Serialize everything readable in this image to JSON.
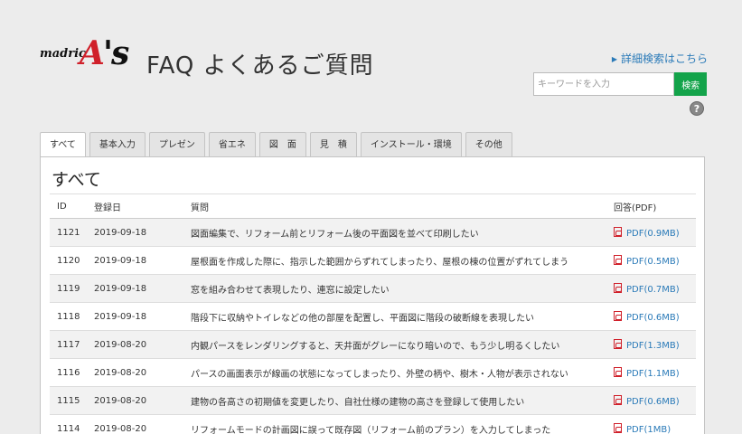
{
  "logo": {
    "small": "madric",
    "big_a": "A",
    "big_rest": "'s"
  },
  "page_title": "FAQ よくあるご質問",
  "advanced_search_link": "詳細検索はこちら",
  "search": {
    "placeholder": "キーワードを入力",
    "button": "検索"
  },
  "help_icon_label": "?",
  "tabs": [
    "すべて",
    "基本入力",
    "プレゼン",
    "省エネ",
    "図　面",
    "見　積",
    "インストール・環境",
    "その他"
  ],
  "active_tab": 0,
  "panel_title": "すべて",
  "table": {
    "headers": {
      "id": "ID",
      "date": "登録日",
      "question": "質問",
      "pdf": "回答(PDF)"
    },
    "rows": [
      {
        "id": "1121",
        "date": "2019-09-18",
        "question": "図面編集で、リフォーム前とリフォーム後の平面図を並べて印刷したい",
        "pdf": "PDF(0.9MB)"
      },
      {
        "id": "1120",
        "date": "2019-09-18",
        "question": "屋根面を作成した際に、指示した範囲からずれてしまったり、屋根の棟の位置がずれてしまう",
        "pdf": "PDF(0.5MB)"
      },
      {
        "id": "1119",
        "date": "2019-09-18",
        "question": "窓を組み合わせて表現したり、連窓に設定したい",
        "pdf": "PDF(0.7MB)"
      },
      {
        "id": "1118",
        "date": "2019-09-18",
        "question": "階段下に収納やトイレなどの他の部屋を配置し、平面図に階段の破断線を表現したい",
        "pdf": "PDF(0.6MB)"
      },
      {
        "id": "1117",
        "date": "2019-08-20",
        "question": "内観パースをレンダリングすると、天井面がグレーになり暗いので、もう少し明るくしたい",
        "pdf": "PDF(1.3MB)"
      },
      {
        "id": "1116",
        "date": "2019-08-20",
        "question": "パースの画面表示が線画の状態になってしまったり、外壁の柄や、樹木・人物が表示されない",
        "pdf": "PDF(1.1MB)"
      },
      {
        "id": "1115",
        "date": "2019-08-20",
        "question": "建物の各高さの初期値を変更したり、自社仕様の建物の高さを登録して使用したい",
        "pdf": "PDF(0.6MB)"
      },
      {
        "id": "1114",
        "date": "2019-08-20",
        "question": "リフォームモードの計画図に誤って既存図（リフォーム前のプラン）を入力してしまった",
        "pdf": "PDF(1MB)"
      }
    ]
  }
}
